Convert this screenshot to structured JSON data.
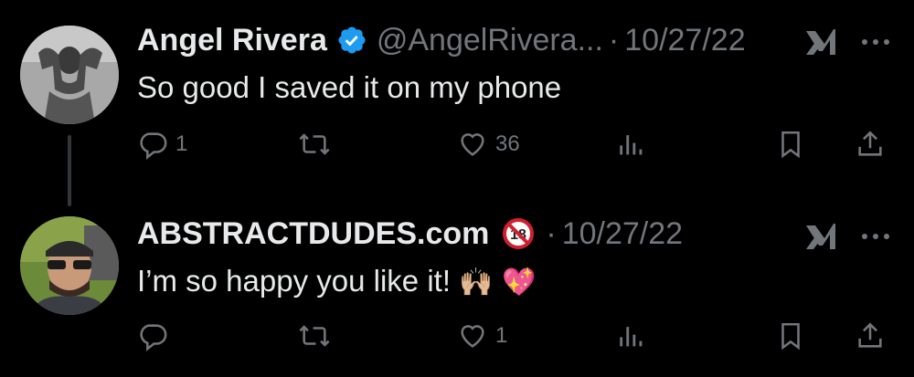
{
  "tweets": [
    {
      "display_name": "Angel Rivera",
      "handle": "@AngelRivera...",
      "separator": "·",
      "date": "10/27/22",
      "text": "So good I saved it on my phone",
      "emoji": "",
      "replies": "1",
      "retweets": "",
      "likes": "36",
      "verified": true
    },
    {
      "display_name": "ABSTRACTDUDES.com",
      "handle": "",
      "separator": "·",
      "date": "10/27/22",
      "text": "I’m so happy you like it!",
      "emoji": "🙌🏼 💖",
      "replies": "",
      "retweets": "",
      "likes": "1",
      "verified": false
    }
  ],
  "colors": {
    "background": "#000000",
    "primary_text": "#e7e9ea",
    "secondary_text": "#71767b",
    "verified_blue": "#1d9bf0",
    "thread_line": "#333639"
  },
  "icons": [
    "verified-badge-icon",
    "no-under-18-icon",
    "grok-icon",
    "more-icon",
    "reply-icon",
    "retweet-icon",
    "like-icon",
    "views-icon",
    "bookmark-icon",
    "share-icon"
  ]
}
